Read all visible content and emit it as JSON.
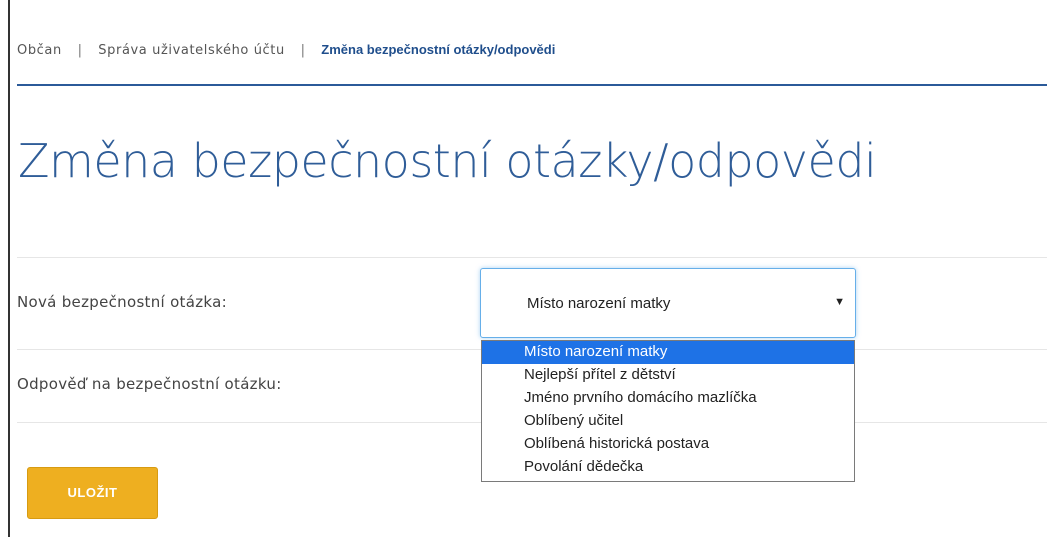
{
  "breadcrumb": {
    "items": [
      "Občan",
      "Správa uživatelského účtu"
    ],
    "separator": "|",
    "current": "Změna bezpečnostní otázky/odpovědi"
  },
  "page_title": "Změna bezpečnostní otázky/odpovědi",
  "form": {
    "question_label": "Nová bezpečnostní otázka:",
    "question_selected": "Místo narození matky",
    "question_options": [
      "Místo narození matky",
      "Nejlepší přítel z dětství",
      "Jméno prvního domácího mazlíčka",
      "Oblíbený učitel",
      "Oblíbená historická postava",
      "Povolání dědečka"
    ],
    "answer_label": "Odpověď na bezpečnostní otázku:",
    "save_label": "ULOŽIT"
  },
  "icons": {
    "select_caret": "triangle-down-icon"
  },
  "colors": {
    "brand_blue": "#2f5d98",
    "breadcrumb_current": "#1f4e8c",
    "button": "#eeaf20",
    "option_highlight": "#1e72e6"
  }
}
